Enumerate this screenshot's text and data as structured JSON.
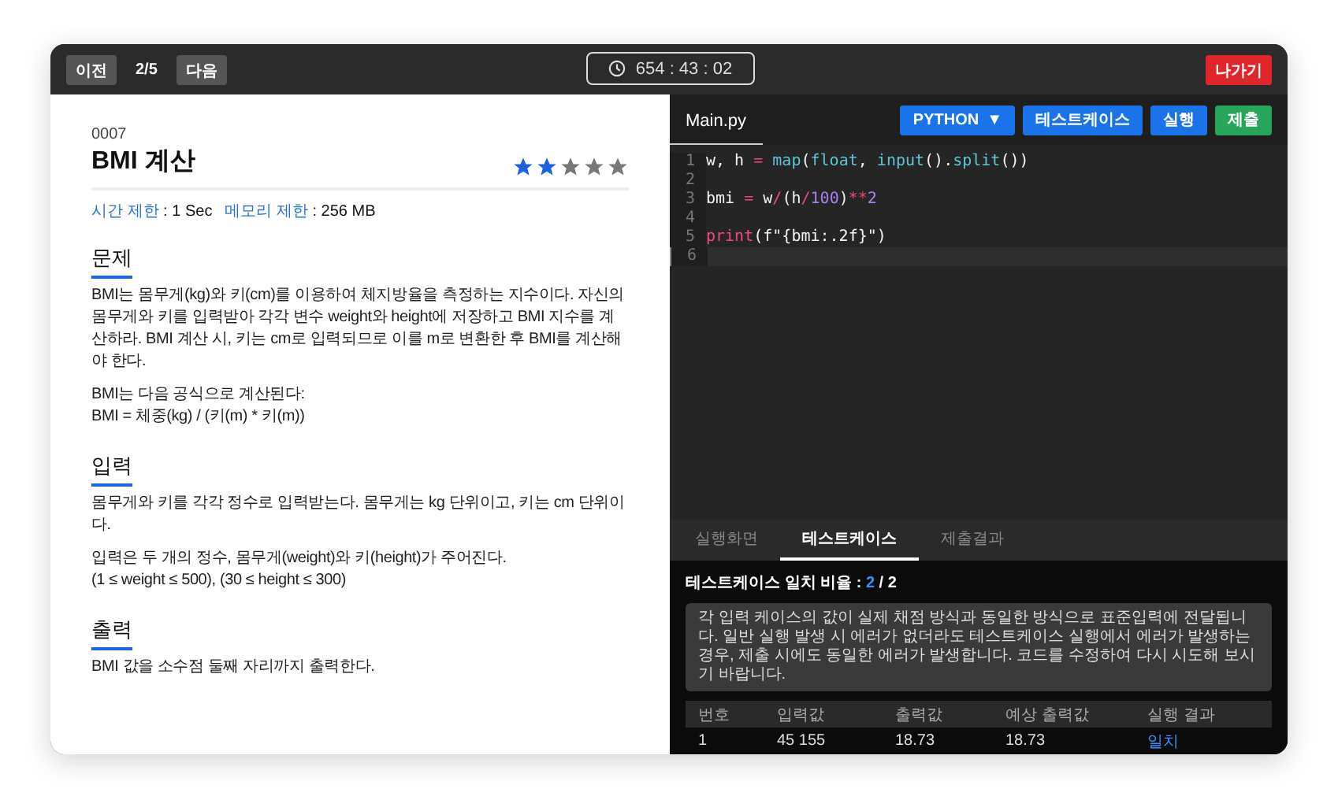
{
  "top_bar": {
    "prev_button": "이전",
    "progress": "2/5",
    "next_button": "다음",
    "timer": "654 : 43 : 02",
    "exit_button": "나가기"
  },
  "problem": {
    "number": "0007",
    "title": "BMI 계산",
    "stars": 2,
    "limits": [
      {
        "label": "시간 제한",
        "value": ": 1 Sec"
      },
      {
        "label": "메모리 제한",
        "value": ": 256 MB"
      }
    ],
    "sections": [
      {
        "heading": "문제",
        "paragraphs": [
          "BMI는 몸무게(kg)와 키(cm)를 이용하여 체지방율을 측정하는 지수이다. 자신의 몸무게와 키를 입력받아 각각 변수 weight와 height에 저장하고 BMI 지수를 계산하라. BMI 계산 시, 키는 cm로 입력되므로 이를 m로 변환한 후 BMI를 계산해야 한다.",
          "BMI는 다음 공식으로 계산된다:\nBMI = 체중(kg) / (키(m) * 키(m))"
        ]
      },
      {
        "heading": "입력",
        "paragraphs": [
          "몸무게와 키를 각각 정수로 입력받는다. 몸무게는 kg 단위이고, 키는 cm 단위이다.",
          "입력은 두 개의 정수, 몸무게(weight)와 키(height)가 주어진다.\n(1 ≤ weight ≤ 500), (30 ≤ height ≤ 300)"
        ]
      },
      {
        "heading": "출력",
        "paragraphs": [
          "BMI 값을 소수점 둘째 자리까지 출력한다."
        ]
      }
    ]
  },
  "editor": {
    "file_tab": "Main.py",
    "language": "PYTHON",
    "language_caret": "▼",
    "buttons": [
      {
        "label": "테스트케이스",
        "kind": "primary"
      },
      {
        "label": "실행",
        "kind": "primary"
      },
      {
        "label": "제출",
        "kind": "submit"
      }
    ],
    "lines": [
      {
        "number": "1",
        "current": false,
        "tokens": [
          {
            "text": "w, h ",
            "kind": "plain"
          },
          {
            "text": "=",
            "kind": "op"
          },
          {
            "text": " map",
            "kind": "fn"
          },
          {
            "text": "(",
            "kind": "plain"
          },
          {
            "text": "float",
            "kind": "fn"
          },
          {
            "text": ", ",
            "kind": "plain"
          },
          {
            "text": "input",
            "kind": "fn"
          },
          {
            "text": "().",
            "kind": "plain"
          },
          {
            "text": "split",
            "kind": "fn"
          },
          {
            "text": "())",
            "kind": "plain"
          }
        ]
      },
      {
        "number": "2",
        "current": false
      },
      {
        "number": "3",
        "current": false,
        "tokens": [
          {
            "text": "bmi ",
            "kind": "plain"
          },
          {
            "text": "=",
            "kind": "op"
          },
          {
            "text": " w",
            "kind": "plain"
          },
          {
            "text": "/",
            "kind": "op"
          },
          {
            "text": "(h",
            "kind": "plain"
          },
          {
            "text": "/",
            "kind": "op"
          },
          {
            "text": "100",
            "kind": "num"
          },
          {
            "text": ")",
            "kind": "plain"
          },
          {
            "text": "**",
            "kind": "op"
          },
          {
            "text": "2",
            "kind": "num"
          }
        ]
      },
      {
        "number": "4",
        "current": false
      },
      {
        "number": "5",
        "current": false,
        "tokens": [
          {
            "text": "print",
            "kind": "kw"
          },
          {
            "text": "(f\"{bmi:.2f}\")",
            "kind": "plain"
          }
        ]
      },
      {
        "number": "6",
        "current": true
      }
    ]
  },
  "result_panel": {
    "tabs": [
      {
        "label": "실행화면",
        "selected": false
      },
      {
        "label": "테스트케이스",
        "selected": true
      },
      {
        "label": "제출결과",
        "selected": false
      }
    ],
    "ratio": {
      "label": "테스트케이스 일치 비율 :",
      "matched": "2",
      "separator": "/",
      "total": "2"
    },
    "notice": "각 입력 케이스의 값이 실제 채점 방식과 동일한 방식으로 표준입력에 전달됩니다. 일반 실행 발생 시 에러가 없더라도 테스트케이스 실행에서 에러가 발생하는 경우, 제출 시에도 동일한 에러가 발생합니다. 코드를 수정하여 다시 시도해 보시기 바랍니다.",
    "table": {
      "columns": [
        "번호",
        "입력값",
        "출력값",
        "예상 출력값",
        "실행 결과"
      ],
      "rows": [
        {
          "cells": [
            "1",
            "45 155",
            "18.73",
            "18.73",
            "일치"
          ]
        }
      ]
    }
  }
}
